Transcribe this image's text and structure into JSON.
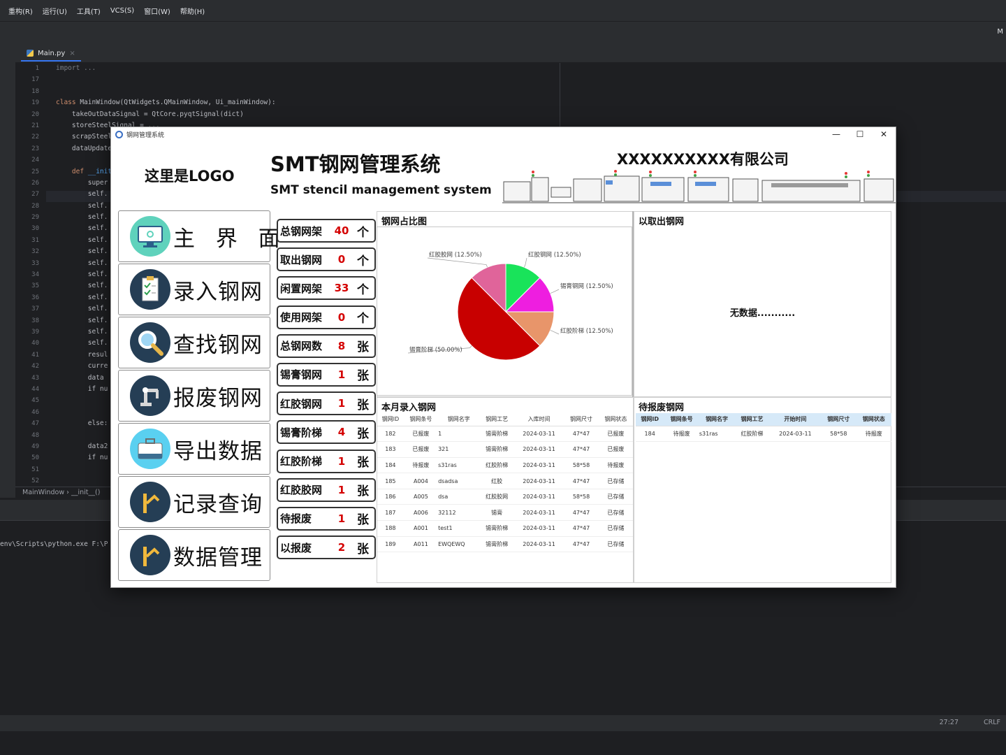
{
  "ide": {
    "menu": [
      "重构(R)",
      "运行(U)",
      "工具(T)",
      "VCS(S)",
      "窗口(W)",
      "帮助(H)"
    ],
    "right_tab": "M",
    "tab": "Main.py",
    "line_numbers": [
      "1",
      "17",
      "18",
      "19",
      "20",
      "21",
      "22",
      "23",
      "24",
      "25",
      "26",
      "27",
      "28",
      "29",
      "30",
      "31",
      "32",
      "33",
      "34",
      "35",
      "36",
      "37",
      "38",
      "39",
      "40",
      "41",
      "42",
      "43",
      "44",
      "45",
      "46",
      "47",
      "48",
      "49",
      "50",
      "51",
      "52"
    ],
    "code": {
      "l1": "import ...",
      "l19_kw": "class ",
      "l19_rest": "MainWindow(QtWidgets.QMainWindow, Ui_mainWindow):",
      "l20": "    takeOutDataSignal = QtCore.pyqtSignal(dict)",
      "l21": "    storeSteelSignal = ...",
      "l22": "    scrapSteel...",
      "l23": "    dataUpdate...",
      "l25_kw": "    def ",
      "l25_rest": "__init__",
      "l26": "        super",
      "self": "        self.",
      "l41": "        resul",
      "l42": "        curre",
      "l43": "        data",
      "l44": "        if nu",
      "l47": "        else:",
      "l49": "        data2",
      "l50": "        if nu"
    },
    "breadcrumb": "MainWindow  ›  __init__()",
    "console_line": "env\\Scripts\\python.exe F:\\P",
    "status_pos": "27:27",
    "status_ending": "CRLF"
  },
  "window": {
    "title": "钢网管理系统",
    "minimize": "—",
    "maximize": "☐",
    "close": "✕"
  },
  "header": {
    "logo_text": "这里是LOGO",
    "title": "SMT钢网管理系统",
    "subtitle": "SMT stencil management system",
    "company": "XXXXXXXXXX有限公司"
  },
  "nav": [
    {
      "label": "主 界 面",
      "icon": "monitor-icon"
    },
    {
      "label": "录入钢网",
      "icon": "clipboard-check-icon"
    },
    {
      "label": "查找钢网",
      "icon": "magnifier-icon"
    },
    {
      "label": "报废钢网",
      "icon": "robot-arm-icon"
    },
    {
      "label": "导出数据",
      "icon": "briefcase-icon"
    },
    {
      "label": "记录查询",
      "icon": "robot-arm-icon"
    },
    {
      "label": "数据管理",
      "icon": "robot-arm-icon"
    }
  ],
  "stats": [
    {
      "label": "总钢网架",
      "value": "40",
      "unit": "个"
    },
    {
      "label": "取出钢网",
      "value": "0",
      "unit": "个"
    },
    {
      "label": "闲置网架",
      "value": "33",
      "unit": "个"
    },
    {
      "label": "使用网架",
      "value": "0",
      "unit": "个"
    },
    {
      "label": "总钢网数",
      "value": "8",
      "unit": "张"
    },
    {
      "label": "锡膏钢网",
      "value": "1",
      "unit": "张"
    },
    {
      "label": "红胶钢网",
      "value": "1",
      "unit": "张"
    },
    {
      "label": "锡膏阶梯",
      "value": "4",
      "unit": "张"
    },
    {
      "label": "红胶阶梯",
      "value": "1",
      "unit": "张"
    },
    {
      "label": "红胶胶网",
      "value": "1",
      "unit": "张"
    },
    {
      "label": "待报废",
      "value": "1",
      "unit": "张"
    },
    {
      "label": "以报废",
      "value": "2",
      "unit": "张"
    }
  ],
  "pie_panel": {
    "title": "钢网占比图",
    "chart_data": {
      "type": "pie",
      "slices": [
        {
          "label": "红胶钢网 (12.50%)",
          "value": 12.5,
          "color": "#19e35a"
        },
        {
          "label": "锡膏钢网 (12.50%)",
          "value": 12.5,
          "color": "#ee1ee0"
        },
        {
          "label": "红胶阶梯 (12.50%)",
          "value": 12.5,
          "color": "#e8956a"
        },
        {
          "label": "锡膏阶梯 (50.00%)",
          "value": 50.0,
          "color": "#c80000"
        },
        {
          "label": "红胶胶网 (12.50%)",
          "value": 12.5,
          "color": "#e0649a"
        }
      ]
    }
  },
  "taken_panel": {
    "title": "以取出钢网",
    "empty_text": "无数据..........."
  },
  "month_panel": {
    "title": "本月录入钢网",
    "columns": [
      "钢网ID",
      "钢网条号",
      "钢网名字",
      "钢网工艺",
      "入库时间",
      "钢网尺寸",
      "钢网状态"
    ],
    "rows": [
      [
        "182",
        "已报废",
        "1",
        "锡膏阶梯",
        "2024-03-11",
        "47*47",
        "已报废"
      ],
      [
        "183",
        "已报废",
        "321",
        "锡膏阶梯",
        "2024-03-11",
        "47*47",
        "已报废"
      ],
      [
        "184",
        "待报废",
        "s31ras",
        "红胶阶梯",
        "2024-03-11",
        "58*58",
        "待报废"
      ],
      [
        "185",
        "A004",
        "dsadsa",
        "红胶",
        "2024-03-11",
        "47*47",
        "已存储"
      ],
      [
        "186",
        "A005",
        "dsa",
        "红胶胶网",
        "2024-03-11",
        "58*58",
        "已存储"
      ],
      [
        "187",
        "A006",
        "32112",
        "锡膏",
        "2024-03-11",
        "47*47",
        "已存储"
      ],
      [
        "188",
        "A001",
        "test1",
        "锡膏阶梯",
        "2024-03-11",
        "47*47",
        "已存储"
      ],
      [
        "189",
        "A011",
        "EWQEWQ",
        "锡膏阶梯",
        "2024-03-11",
        "47*47",
        "已存储"
      ]
    ]
  },
  "scrap_panel": {
    "title": "待报废钢网",
    "columns": [
      "钢网ID",
      "钢网条号",
      "钢网名字",
      "钢网工艺",
      "开始时间",
      "钢网尺寸",
      "钢网状态"
    ],
    "rows": [
      [
        "184",
        "待报废",
        "s31ras",
        "红胶阶梯",
        "2024-03-11",
        "58*58",
        "待报废"
      ]
    ]
  }
}
